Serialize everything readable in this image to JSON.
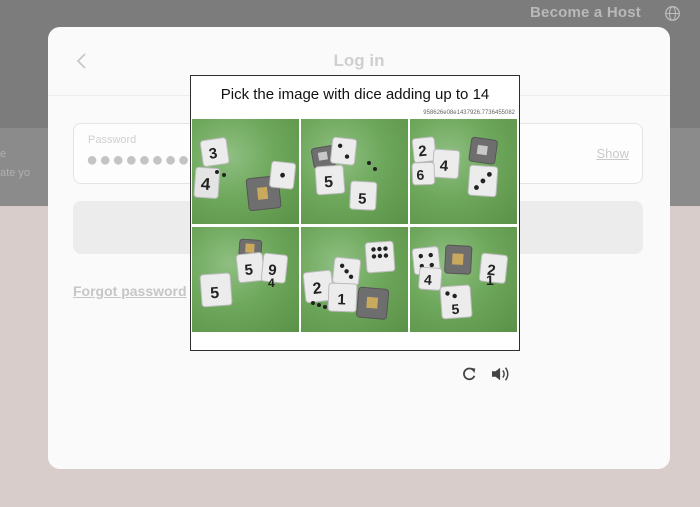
{
  "header": {
    "become_host": "Become a Host",
    "globe_icon": "globe-icon"
  },
  "background": {
    "side_text_1": "e",
    "side_text_2": "ate yo"
  },
  "login_modal": {
    "title": "Log in",
    "back_icon": "chevron-left-icon",
    "password_label": "Password",
    "password_value": "●●●●●●●●",
    "show_label": "Show",
    "forgot_label": "Forgot password"
  },
  "captcha": {
    "prompt": "Pick the image with dice adding up to 14",
    "challenge_id": "958626e08e1437926.7736455082",
    "reload_icon": "reload-icon",
    "audio_icon": "audio-icon",
    "tiles": [
      {
        "label": "dice-image-1"
      },
      {
        "label": "dice-image-2"
      },
      {
        "label": "dice-image-3"
      },
      {
        "label": "dice-image-4"
      },
      {
        "label": "dice-image-5"
      },
      {
        "label": "dice-image-6"
      }
    ]
  },
  "colors": {
    "overlay": "#7f7f7f",
    "lower_band": "#d9cdcb",
    "modal_bg": "#fafafa",
    "grass": "#6ea85c",
    "die_face": "#ececec",
    "die_pips": "#222222"
  }
}
